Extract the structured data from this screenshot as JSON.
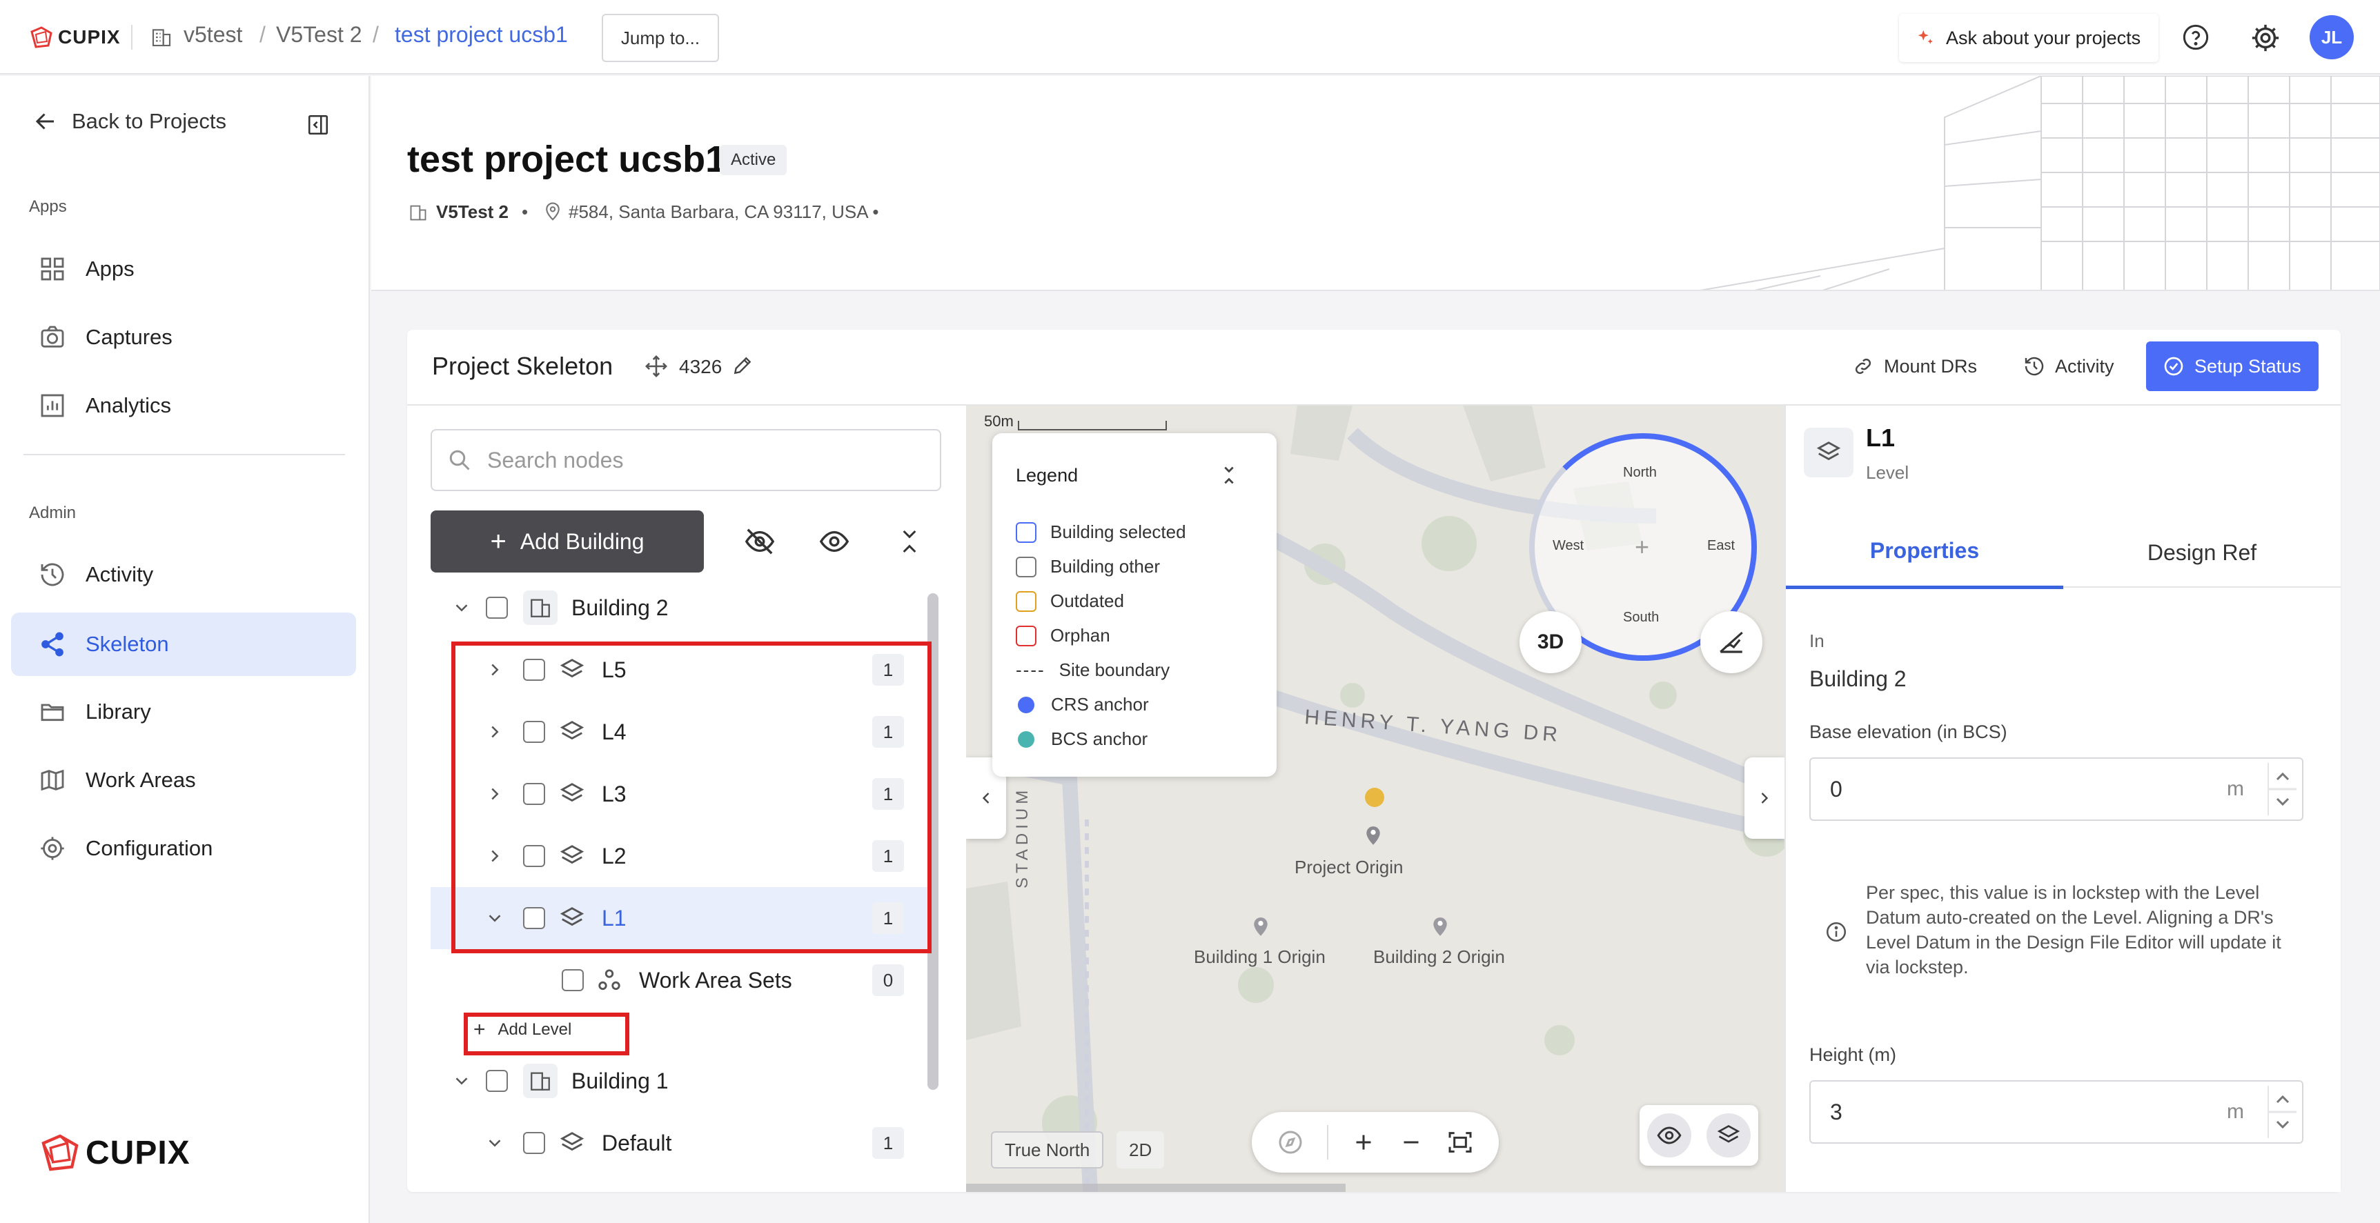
{
  "topbar": {
    "logo_text": "CUPIX",
    "breadcrumb": [
      "v5test",
      "V5Test 2",
      "test project ucsb1"
    ],
    "separator": "/",
    "jump_label": "Jump to...",
    "ask_label": "Ask about your projects",
    "avatar_initials": "JL"
  },
  "sidebar": {
    "back_label": "Back to Projects",
    "apps_section": "Apps",
    "admin_section": "Admin",
    "apps_items": [
      {
        "label": "Apps",
        "icon": "grid-icon"
      },
      {
        "label": "Captures",
        "icon": "camera-icon"
      },
      {
        "label": "Analytics",
        "icon": "chart-icon"
      }
    ],
    "admin_items": [
      {
        "label": "Activity",
        "icon": "history-icon"
      },
      {
        "label": "Skeleton",
        "icon": "skeleton-icon",
        "selected": true
      },
      {
        "label": "Library",
        "icon": "folder-icon"
      },
      {
        "label": "Work Areas",
        "icon": "map-icon"
      },
      {
        "label": "Configuration",
        "icon": "gear-icon"
      }
    ],
    "footer_logo": "CUPIX"
  },
  "project": {
    "title": "test project ucsb1",
    "status": "Active",
    "org": "V5Test 2",
    "bullet": "•",
    "address": "#584, Santa Barbara, CA 93117, USA •"
  },
  "skeleton": {
    "title": "Project Skeleton",
    "crs_code": "4326",
    "mount_label": "Mount DRs",
    "activity_label": "Activity",
    "setup_label": "Setup Status",
    "search_placeholder": "Search nodes",
    "add_building_label": "Add Building",
    "add_level_label": "Add Level",
    "plus": "+",
    "tree": [
      {
        "label": "Building 2",
        "type": "building",
        "expanded": true
      },
      {
        "label": "L5",
        "type": "level",
        "count": "1"
      },
      {
        "label": "L4",
        "type": "level",
        "count": "1"
      },
      {
        "label": "L3",
        "type": "level",
        "count": "1"
      },
      {
        "label": "L2",
        "type": "level",
        "count": "1"
      },
      {
        "label": "L1",
        "type": "level",
        "count": "1",
        "selected": true,
        "expanded": true
      },
      {
        "label": "Work Area Sets",
        "type": "workarea",
        "count": "0"
      },
      {
        "label": "Building 1",
        "type": "building",
        "expanded": true
      },
      {
        "label": "Default",
        "type": "level",
        "count": "1",
        "expanded": true
      }
    ]
  },
  "map": {
    "scale_label": "50m",
    "legend_title": "Legend",
    "legend": [
      {
        "label": "Building selected",
        "color": "#4a6cf7"
      },
      {
        "label": "Building other",
        "color": "#777777"
      },
      {
        "label": "Outdated",
        "color": "#e0a020"
      },
      {
        "label": "Orphan",
        "color": "#e03030"
      },
      {
        "label": "Site boundary",
        "marker": "----"
      },
      {
        "label": "CRS anchor",
        "color": "#4a6cf7"
      },
      {
        "label": "BCS anchor",
        "color": "#4ab5b0"
      }
    ],
    "compass": {
      "north": "North",
      "south": "South",
      "east": "East",
      "west": "West"
    },
    "mode_3d": "3D",
    "street_label": "HENRY T. YANG DR",
    "street2_label": "STADIUM RD",
    "project_origin": "Project Origin",
    "building1_origin": "Building 1 Origin",
    "building2_origin": "Building 2 Origin",
    "true_north_label": "True North",
    "mode_2d": "2D"
  },
  "details": {
    "title": "L1",
    "subtitle": "Level",
    "tabs": [
      "Properties",
      "Design Ref"
    ],
    "in_label": "In",
    "in_value": "Building 2",
    "base_elev_label": "Base elevation (in BCS)",
    "base_elev_value": "0",
    "unit": "m",
    "note": "Per spec, this value is in lockstep with the Level Datum auto-created on the Level. Aligning a DR's Level Datum in the Design File Editor will update it via lockstep.",
    "height_label": "Height (m)",
    "height_value": "3"
  }
}
